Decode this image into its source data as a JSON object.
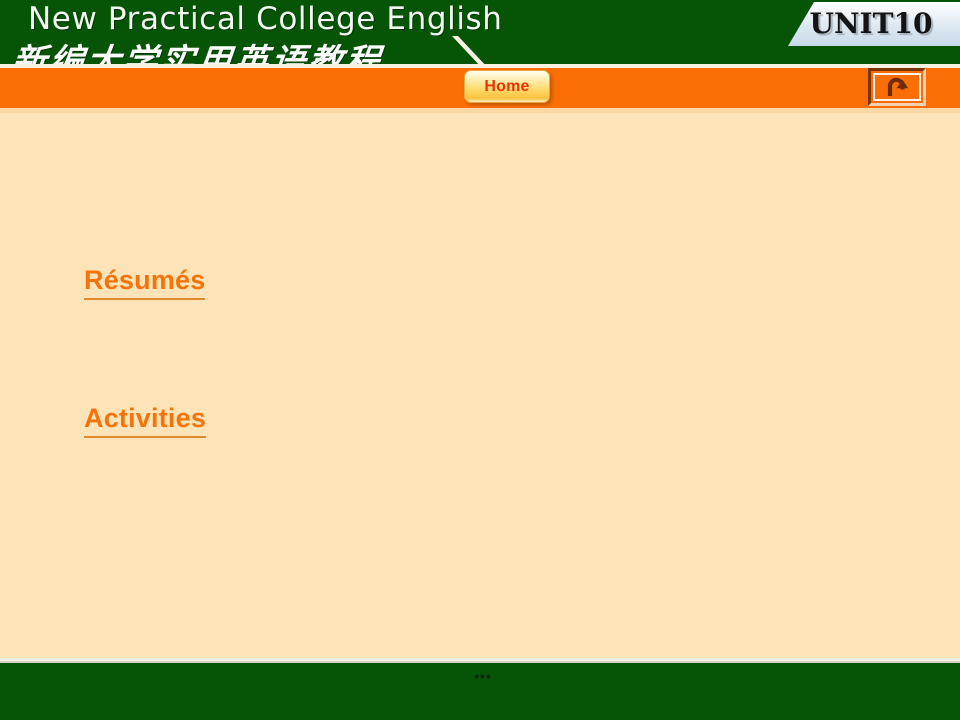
{
  "header": {
    "title_en": "New Practical College English",
    "title_cn": "新编大学实用英语教程",
    "unit_badge": "UNIT10",
    "home_label": "Home",
    "return_icon_name": "u-turn-arrow-icon"
  },
  "content": {
    "links": [
      {
        "label": "Résumés"
      },
      {
        "label": "Activities"
      }
    ]
  },
  "footer": {
    "page_mark": "•••"
  },
  "colors": {
    "header_green": "#065406",
    "orange_bar": "#fb6e05",
    "body_cream": "#fce3b8",
    "link_orange": "#f4740a",
    "link_underline": "#e08b2a",
    "home_text_red": "#e8350c",
    "badge_light": "#dde9f2"
  }
}
